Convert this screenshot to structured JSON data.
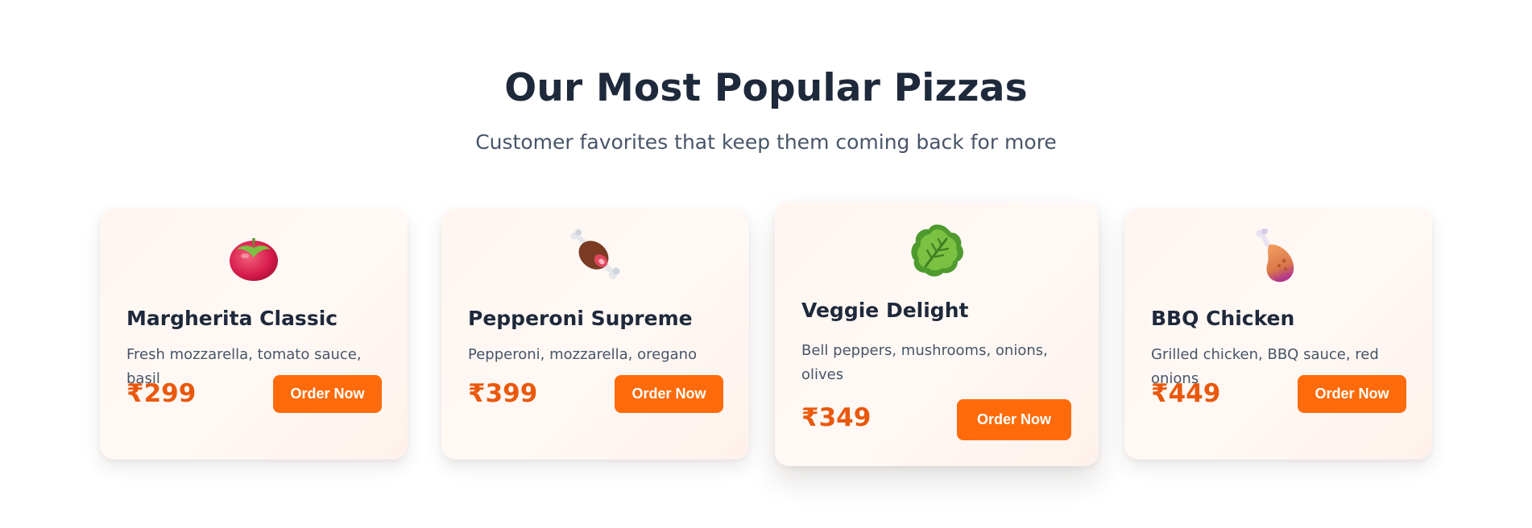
{
  "header": {
    "title": "Our Most Popular Pizzas",
    "subtitle": "Customer favorites that keep them coming back for more"
  },
  "cards": [
    {
      "icon": "tomato-icon",
      "name": "Margherita Classic",
      "description": "Fresh mozzarella, tomato sauce, basil",
      "price": "₹299",
      "button_label": "Order Now"
    },
    {
      "icon": "meat-on-bone-icon",
      "name": "Pepperoni Supreme",
      "description": "Pepperoni, mozzarella, oregano",
      "price": "₹399",
      "button_label": "Order Now"
    },
    {
      "icon": "leafy-green-icon",
      "name": "Veggie Delight",
      "description": "Bell peppers, mushrooms, onions, olives",
      "price": "₹349",
      "button_label": "Order Now"
    },
    {
      "icon": "poultry-leg-icon",
      "name": "BBQ Chicken",
      "description": "Grilled chicken, BBQ sauce, red onions",
      "price": "₹449",
      "button_label": "Order Now"
    }
  ],
  "colors": {
    "accent": "#ff6b0a",
    "price": "#ea580c",
    "heading": "#1e293b",
    "body_text": "#475569",
    "card_background": "#fff6f1"
  }
}
